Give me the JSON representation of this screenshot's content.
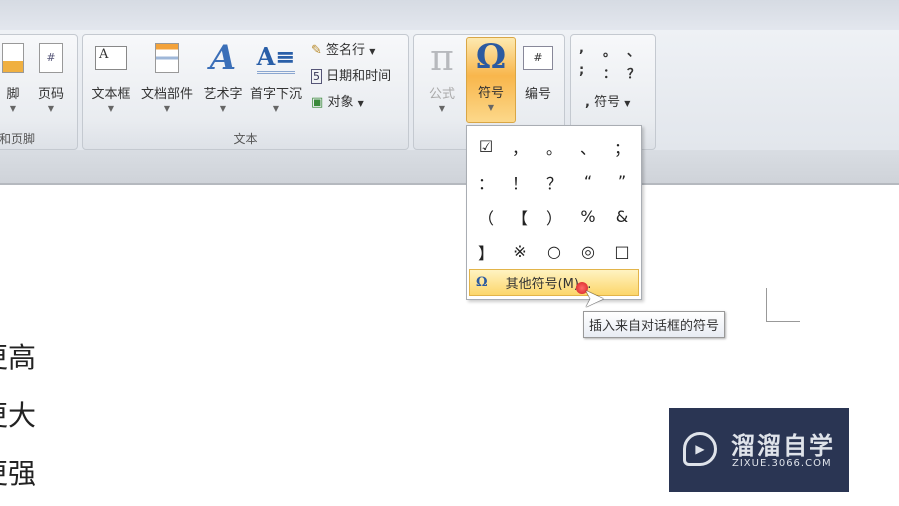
{
  "ribbon": {
    "header_footer": {
      "page_number": "页码",
      "footer_partial": "脚",
      "group_label": "和页脚"
    },
    "text_group": {
      "label": "文本",
      "text_box": "文本框",
      "quick_parts": "文档部件",
      "wordart": "艺术字",
      "drop_cap": "首字下沉",
      "signature_line": "签名行",
      "date_time": "日期和时间",
      "object": "对象"
    },
    "symbols_group": {
      "equation": "公式",
      "symbol": "符号",
      "numbering": "编号"
    },
    "special": {
      "chars": [
        ",",
        "。",
        "、",
        ";",
        "：",
        "？"
      ],
      "symbol": "符号"
    }
  },
  "symbol_menu": {
    "symbols": [
      "☑",
      "，",
      "。",
      "、",
      "；",
      "：",
      "！",
      "？",
      "“",
      "”",
      "（",
      "【",
      "）",
      "%",
      "&",
      "】",
      "※",
      "○",
      "◎",
      "□"
    ],
    "more_symbols": "其他符号(M)...",
    "tooltip": "插入来自对话框的符号"
  },
  "document": {
    "lines": [
      "更高",
      "更大",
      "更强"
    ]
  },
  "watermark": {
    "name": "溜溜自学",
    "url": "ZIXUE.3066.COM"
  },
  "colors": {
    "accent": "#f7b64a",
    "watermark_bg": "#2a3553"
  }
}
